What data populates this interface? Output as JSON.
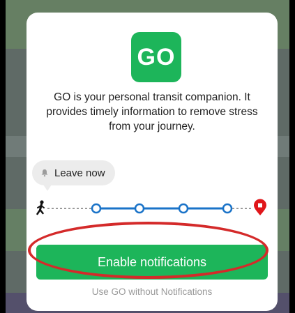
{
  "modal": {
    "logo_text": "GO",
    "description": "GO is your personal transit companion. It provides timely information to remove stress from your journey.",
    "leave_chip_label": "Leave now",
    "primary_button_label": "Enable notifications",
    "secondary_link_label": "Use GO without Notifications"
  },
  "colors": {
    "brand_green": "#1db55a",
    "route_blue": "#1a73c8",
    "destination_red": "#e0161a",
    "annotation_red": "#d42a2a"
  },
  "icons": {
    "bell": "bell-icon",
    "walking": "walking-person-icon",
    "destination": "destination-pin-icon"
  }
}
